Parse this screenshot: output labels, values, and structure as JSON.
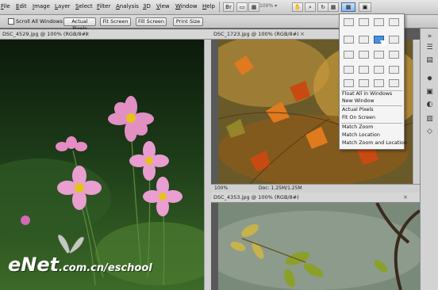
{
  "menubar": {
    "items": [
      {
        "label": "File",
        "underline_index": 0
      },
      {
        "label": "Edit",
        "underline_index": 0
      },
      {
        "label": "Image",
        "underline_index": 0
      },
      {
        "label": "Layer",
        "underline_index": 0
      },
      {
        "label": "Select",
        "underline_index": 0
      },
      {
        "label": "Filter",
        "underline_index": 0
      },
      {
        "label": "Analysis",
        "underline_index": 0
      },
      {
        "label": "3D",
        "underline_index": 0
      },
      {
        "label": "View",
        "underline_index": 0
      },
      {
        "label": "Window",
        "underline_index": 0
      },
      {
        "label": "Help",
        "underline_index": 0
      }
    ],
    "zoom": "100%",
    "arrange_button": "▦"
  },
  "options": {
    "scroll_all_label": "Scroll All Windows",
    "buttons": [
      "Actual Pixels",
      "Fit Screen",
      "Fill Screen",
      "Print Size"
    ]
  },
  "docs": {
    "left_title": "DSC_4529.jpg @ 100% (RGB/8#)",
    "right_top_title": "DSC_1723.jpg @ 100% (RGB/8#)",
    "right_bottom_title": "DSC_4353.jpg @ 100% (RGB/8#)",
    "status_zoom": "100%",
    "status_doc": "Doc: 1.25M/1.25M"
  },
  "dropdown": {
    "items": [
      "Float All in Windows",
      "New Window",
      "Actual Pixels",
      "Fit On Screen",
      "Match Zoom",
      "Match Location",
      "Match Zoom and Location"
    ]
  },
  "watermark": {
    "brand": "eNet",
    "site": ".com.cn/eschool"
  },
  "colors": {
    "accent": "#4a90d9",
    "chrome": "#d6d6d6"
  }
}
